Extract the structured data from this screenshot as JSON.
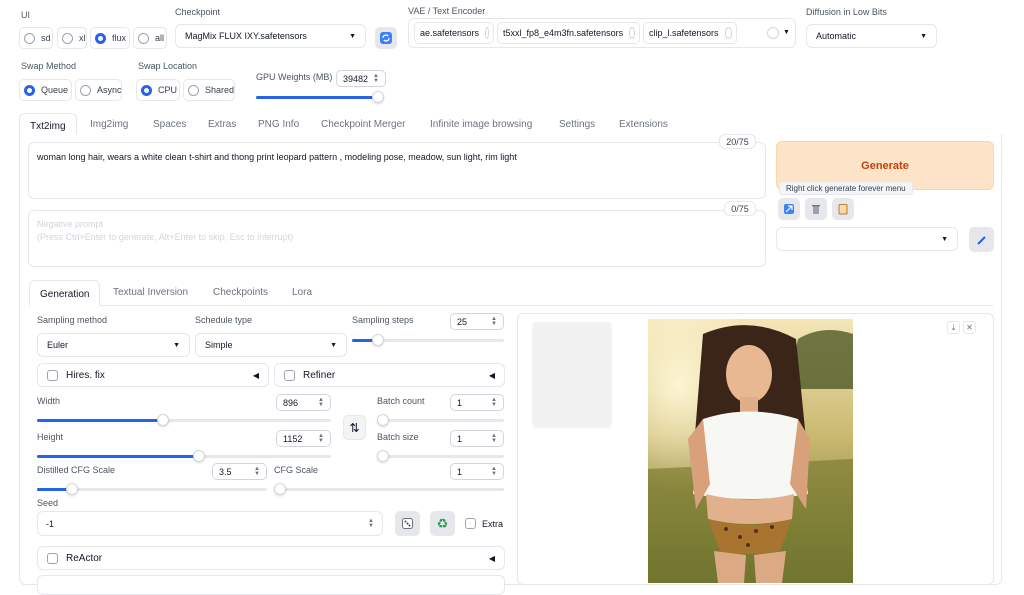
{
  "top": {
    "ui_label": "UI",
    "ui_options": [
      "sd",
      "xl",
      "flux",
      "all"
    ],
    "ui_selected": "flux",
    "checkpoint_label": "Checkpoint",
    "checkpoint_value": "MagMix FLUX IXY.safetensors",
    "vae_label": "VAE / Text Encoder",
    "vae_items": [
      "ae.safetensors",
      "t5xxl_fp8_e4m3fn.safetensors",
      "clip_l.safetensors"
    ],
    "diffusion_label": "Diffusion in Low Bits",
    "diffusion_value": "Automatic",
    "swap_method_label": "Swap Method",
    "swap_method_options": [
      "Queue",
      "Async"
    ],
    "swap_location_label": "Swap Location",
    "swap_location_options": [
      "CPU",
      "Shared"
    ],
    "gpu_label": "GPU Weights (MB)",
    "gpu_value": "39482",
    "gpu_fraction": 0.95
  },
  "main_tabs": [
    "Txt2img",
    "Img2img",
    "Spaces",
    "Extras",
    "PNG Info",
    "Checkpoint Merger",
    "Infinite image browsing",
    "Settings",
    "Extensions"
  ],
  "prompt": {
    "text": "woman long hair, wears a white clean t-shirt and thong print leopard pattern , modeling pose, meadow, sun light, rim light",
    "count": "20/75",
    "neg_placeholder_1": "Negative prompt",
    "neg_placeholder_2": "(Press Ctrl+Enter to generate, Alt+Enter to skip, Esc to interrupt)",
    "neg_count": "0/75"
  },
  "generate": {
    "label": "Generate",
    "tooltip": "Right click generate forever menu"
  },
  "sub_tabs": [
    "Generation",
    "Textual Inversion",
    "Checkpoints",
    "Lora"
  ],
  "params": {
    "sampling_method_label": "Sampling method",
    "sampling_method": "Euler",
    "schedule_type_label": "Schedule type",
    "schedule_type": "Simple",
    "sampling_steps_label": "Sampling steps",
    "sampling_steps": "25",
    "sampling_steps_fraction": 0.17,
    "hires_label": "Hires. fix",
    "refiner_label": "Refiner",
    "width_label": "Width",
    "width": "896",
    "width_fraction": 0.43,
    "height_label": "Height",
    "height": "1152",
    "height_fraction": 0.55,
    "batch_count_label": "Batch count",
    "batch_count": "1",
    "batch_size_label": "Batch size",
    "batch_size": "1",
    "distilled_cfg_label": "Distilled CFG Scale",
    "distilled_cfg": "3.5",
    "distilled_cfg_fraction": 0.15,
    "cfg_label": "CFG Scale",
    "cfg": "1",
    "seed_label": "Seed",
    "seed": "-1",
    "extra_label": "Extra",
    "reactor_label": "ReActor"
  },
  "colors": {
    "accent": "#2563eb",
    "generate_bg": "#fde3c8",
    "generate_text": "#c2410c"
  }
}
